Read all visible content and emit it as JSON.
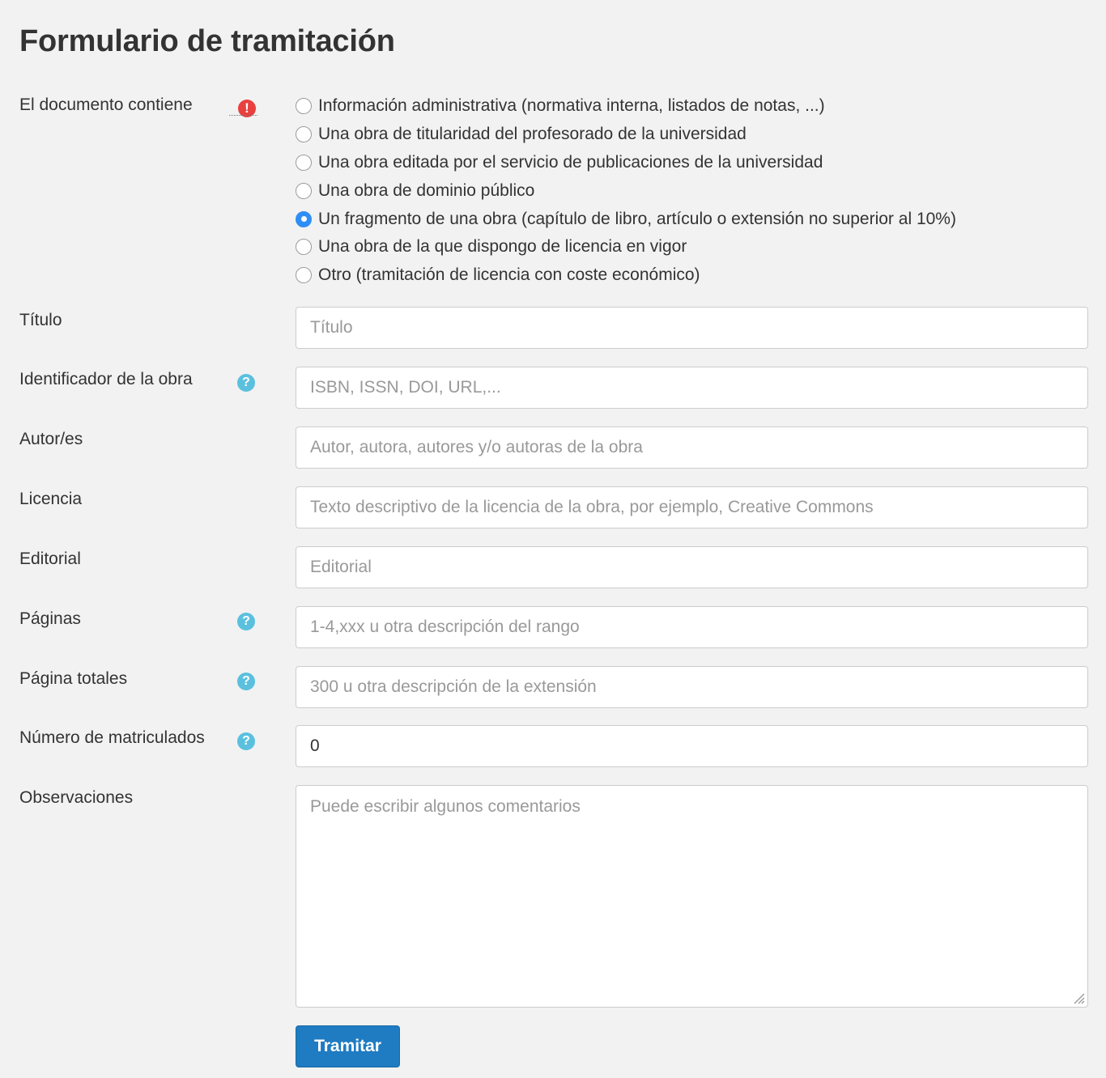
{
  "title": "Formulario de tramitación",
  "document_contains": {
    "label": "El documento contiene",
    "required_icon": "exclamation-icon",
    "options": [
      {
        "label": "Información administrativa (normativa interna, listados de notas, ...)",
        "checked": false
      },
      {
        "label": "Una obra de titularidad del profesorado de la universidad",
        "checked": false
      },
      {
        "label": "Una obra editada por el servicio de publicaciones de la universidad",
        "checked": false
      },
      {
        "label": "Una obra de dominio público",
        "checked": false
      },
      {
        "label": "Un fragmento de una obra (capítulo de libro, artículo o extensión no superior al 10%)",
        "checked": true
      },
      {
        "label": "Una obra de la que dispongo de licencia en vigor",
        "checked": false
      },
      {
        "label": "Otro (tramitación de licencia con coste económico)",
        "checked": false
      }
    ]
  },
  "fields": {
    "titulo": {
      "label": "Título",
      "placeholder": "Título",
      "value": ""
    },
    "identificador": {
      "label": "Identificador de la obra",
      "placeholder": "ISBN, ISSN, DOI, URL,...",
      "value": "",
      "help_icon": "question-icon"
    },
    "autores": {
      "label": "Autor/es",
      "placeholder": "Autor, autora, autores y/o autoras de la obra",
      "value": ""
    },
    "licencia": {
      "label": "Licencia",
      "placeholder": "Texto descriptivo de la licencia de la obra, por ejemplo, Creative Commons",
      "value": ""
    },
    "editorial": {
      "label": "Editorial",
      "placeholder": "Editorial",
      "value": ""
    },
    "paginas": {
      "label": "Páginas",
      "placeholder": "1-4,xxx u otra descripción del rango",
      "value": "",
      "help_icon": "question-icon"
    },
    "paginas_totales": {
      "label": "Página totales",
      "placeholder": "300 u otra descripción de la extensión",
      "value": "",
      "help_icon": "question-icon"
    },
    "matriculados": {
      "label": "Número de matriculados",
      "placeholder": "",
      "value": "0",
      "help_icon": "question-icon"
    },
    "observaciones": {
      "label": "Observaciones",
      "placeholder": "Puede escribir algunos comentarios",
      "value": ""
    }
  },
  "submit_label": "Tramitar",
  "colors": {
    "background": "#f2f2f2",
    "primary_button": "#1f7bc2",
    "help_icon": "#5bc0de",
    "required_icon": "#e8403f",
    "radio_checked": "#2f8ef5"
  }
}
